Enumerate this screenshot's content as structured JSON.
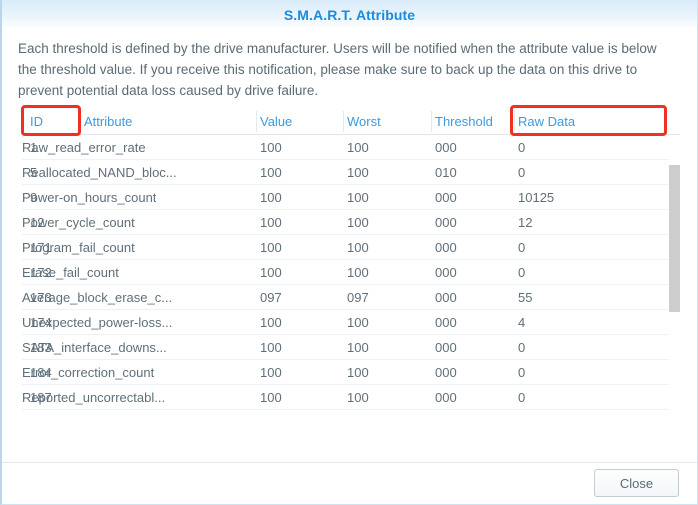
{
  "dialog": {
    "title": "S.M.A.R.T. Attribute",
    "description": "Each threshold is defined by the drive manufacturer. Users will be notified when the attribute value is below the threshold value. If you receive this notification, please make sure to back up the data on this drive to prevent potential data loss caused by drive failure."
  },
  "table": {
    "columns": [
      {
        "key": "id",
        "label": "ID"
      },
      {
        "key": "attribute",
        "label": "Attribute"
      },
      {
        "key": "value",
        "label": "Value"
      },
      {
        "key": "worst",
        "label": "Worst"
      },
      {
        "key": "threshold",
        "label": "Threshold"
      },
      {
        "key": "raw",
        "label": "Raw Data"
      }
    ],
    "rows": [
      {
        "id": "1",
        "attribute": "Raw_read_error_rate",
        "value": "100",
        "worst": "100",
        "threshold": "000",
        "raw": "0"
      },
      {
        "id": "5",
        "attribute": "Reallocated_NAND_bloc...",
        "value": "100",
        "worst": "100",
        "threshold": "010",
        "raw": "0"
      },
      {
        "id": "9",
        "attribute": "Power-on_hours_count",
        "value": "100",
        "worst": "100",
        "threshold": "000",
        "raw": "10125"
      },
      {
        "id": "12",
        "attribute": "Power_cycle_count",
        "value": "100",
        "worst": "100",
        "threshold": "000",
        "raw": "12"
      },
      {
        "id": "171",
        "attribute": "Program_fail_count",
        "value": "100",
        "worst": "100",
        "threshold": "000",
        "raw": "0"
      },
      {
        "id": "172",
        "attribute": "Erase_fail_count",
        "value": "100",
        "worst": "100",
        "threshold": "000",
        "raw": "0"
      },
      {
        "id": "173",
        "attribute": "Average_block_erase_c...",
        "value": "097",
        "worst": "097",
        "threshold": "000",
        "raw": "55"
      },
      {
        "id": "174",
        "attribute": "Unexpected_power-loss...",
        "value": "100",
        "worst": "100",
        "threshold": "000",
        "raw": "4"
      },
      {
        "id": "183",
        "attribute": "SATA_interface_downs...",
        "value": "100",
        "worst": "100",
        "threshold": "000",
        "raw": "0"
      },
      {
        "id": "184",
        "attribute": "Error_correction_count",
        "value": "100",
        "worst": "100",
        "threshold": "000",
        "raw": "0"
      },
      {
        "id": "187",
        "attribute": "Reported_uncorrectabl...",
        "value": "100",
        "worst": "100",
        "threshold": "000",
        "raw": "0"
      }
    ]
  },
  "footer": {
    "close_label": "Close"
  },
  "annotations": {
    "color": "#ef3124",
    "boxes": [
      "ID",
      "Raw Data"
    ]
  },
  "colors": {
    "title": "#1a8bdd",
    "header_text": "#3d9ade",
    "body_text": "#5f6f7a",
    "scrollbar_thumb": "#cdcdcd"
  }
}
